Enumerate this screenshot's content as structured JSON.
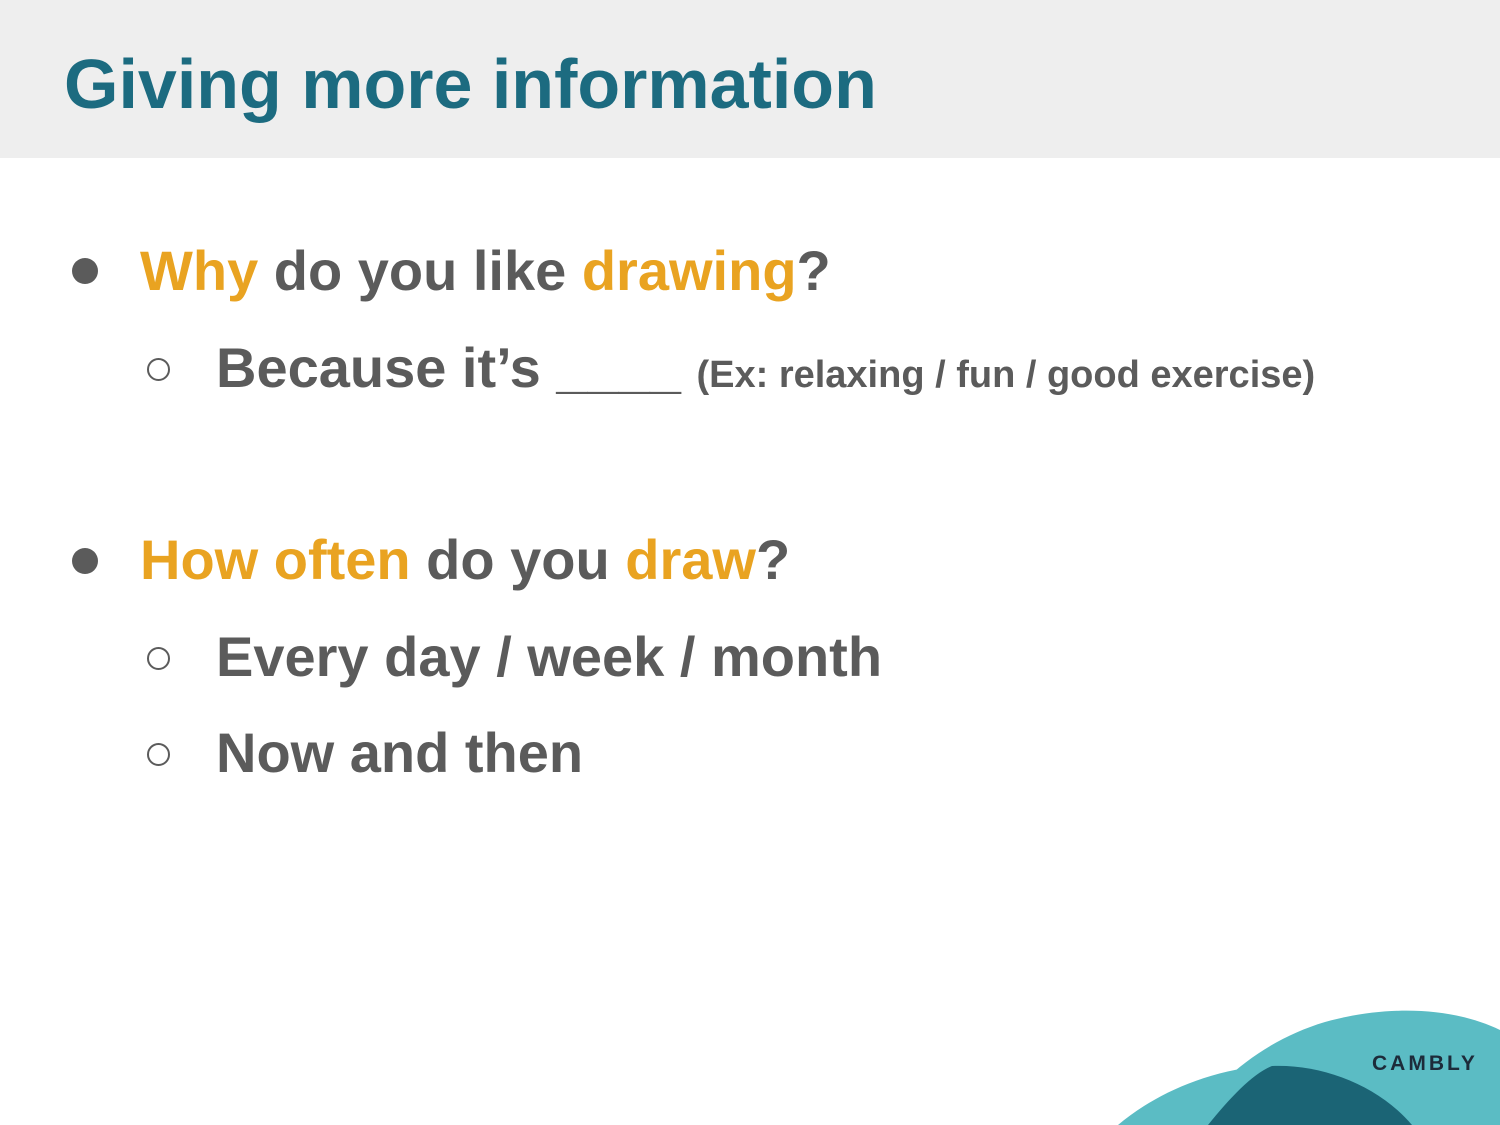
{
  "title": "Giving more information",
  "colors": {
    "title": "#1c6b80",
    "highlight": "#e9a321",
    "text": "#5b5b5b",
    "header_bg": "#eeeeee",
    "wave_light": "#5bbcc4",
    "wave_dark": "#1b6475"
  },
  "q1": {
    "w1": "Why",
    "t1": " do you like ",
    "w2": "drawing",
    "t2": "?"
  },
  "a1": {
    "text": "Because it’s ____ ",
    "example": "(Ex: relaxing / fun / good exercise)"
  },
  "q2": {
    "w1": "How often",
    "t1": " do you ",
    "w2": "draw",
    "t2": "?"
  },
  "a2": "Every day / week / month",
  "a3": "Now and then",
  "logo": "CAMBLY"
}
